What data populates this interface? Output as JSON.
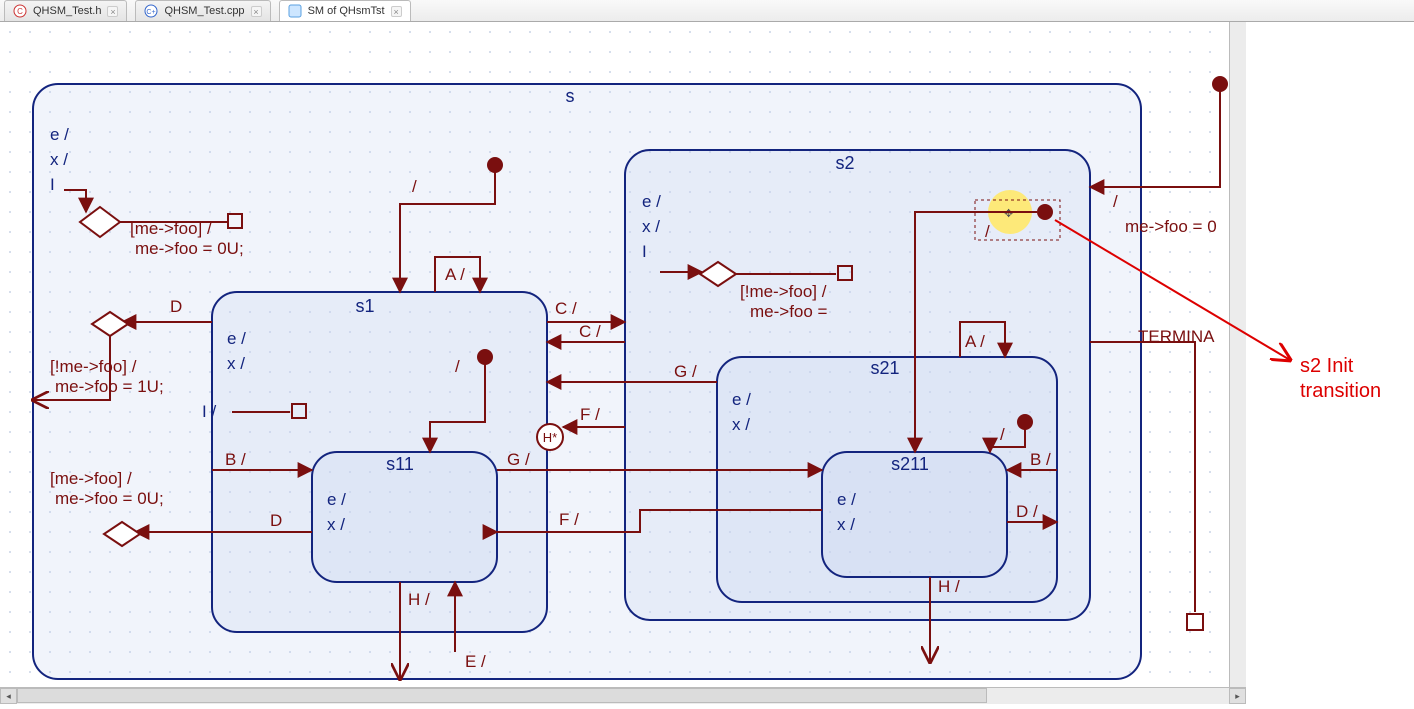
{
  "tabs": [
    {
      "label": "QHSM_Test.h"
    },
    {
      "label": "QHSM_Test.cpp"
    },
    {
      "label": "SM of QHsmTst"
    }
  ],
  "annotation": {
    "line1": "s2 Init",
    "line2": "transition"
  },
  "right_label": "me->foo = 0",
  "right_tr": "/",
  "termina": "TERMINA",
  "states": {
    "s": {
      "name": "s",
      "entry": "e /",
      "exit": "x /",
      "extra": "I"
    },
    "s1": {
      "name": "s1",
      "entry": "e /",
      "exit": "x /",
      "extra": "I /"
    },
    "s11": {
      "name": "s11",
      "entry": "e /",
      "exit": "x /"
    },
    "s2": {
      "name": "s2",
      "entry": "e /",
      "exit": "x /",
      "extra": "I"
    },
    "s21": {
      "name": "s21",
      "entry": "e /",
      "exit": "x /"
    },
    "s211": {
      "name": "s211",
      "entry": "e /",
      "exit": "x /"
    }
  },
  "guards": {
    "g1": {
      "g": "[me->foo] /",
      "a": "me->foo = 0U;"
    },
    "g2": {
      "g": "[!me->foo] /",
      "a": "me->foo = 1U;"
    },
    "g3": {
      "g": "[me->foo] /",
      "a": "me->foo = 0U;"
    },
    "g4": {
      "g": "[!me->foo] /",
      "a": "me->foo ="
    }
  },
  "tr": {
    "slash": "/",
    "A": "A /",
    "B": "B /",
    "C": "C /",
    "D": "D",
    "E": "E /",
    "F": "F /",
    "G": "G /",
    "H": "H /",
    "Donly": "D /"
  }
}
